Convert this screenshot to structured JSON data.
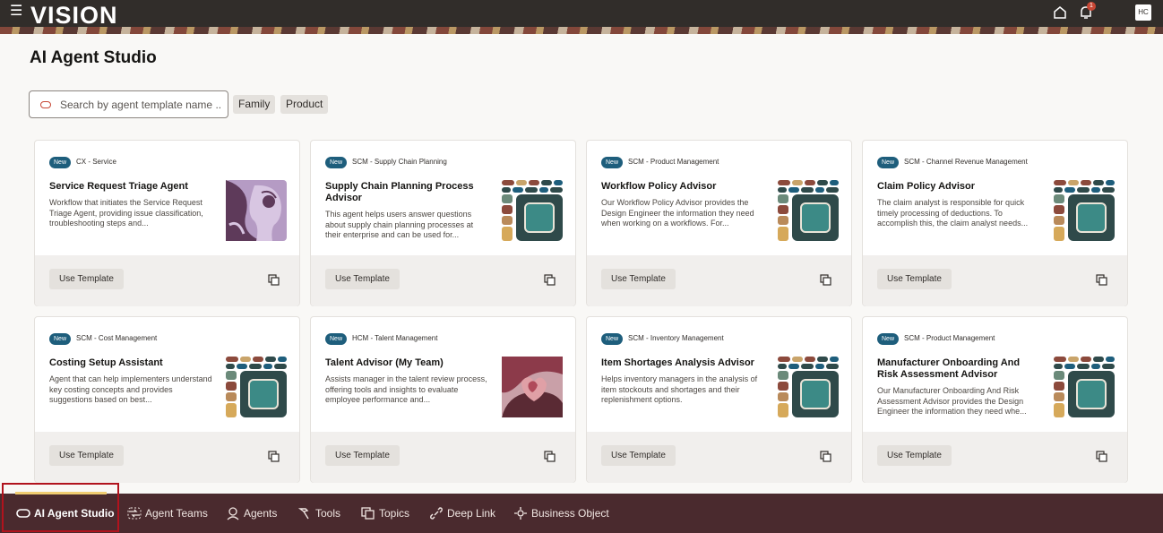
{
  "header": {
    "logo": "VISION",
    "notification_count": "1",
    "user_initials": "HC"
  },
  "page": {
    "title": "AI Agent Studio"
  },
  "search": {
    "placeholder": "Search by agent template name ..."
  },
  "filters": {
    "family": "Family",
    "product": "Product"
  },
  "cards": [
    {
      "badge": "New",
      "family": "CX - Service",
      "title": "Service Request Triage Agent",
      "description": "Workflow that initiates the Service Request Triage Agent, providing issue classification, troubleshooting steps and...",
      "button": "Use Template",
      "illustration": "face-illustration"
    },
    {
      "badge": "New",
      "family": "SCM - Supply Chain Planning",
      "title": "Supply Chain Planning Process Advisor",
      "description": "This agent helps users answer questions about supply chain planning processes at their enterprise and can be used for...",
      "button": "Use Template",
      "illustration": "tiles-illustration"
    },
    {
      "badge": "New",
      "family": "SCM - Product Management",
      "title": "Workflow Policy Advisor",
      "description": "Our Workflow Policy Advisor provides the Design Engineer the information they need when working on a workflows. For...",
      "button": "Use Template",
      "illustration": "tiles-illustration"
    },
    {
      "badge": "New",
      "family": "SCM - Channel Revenue Management",
      "title": "Claim Policy Advisor",
      "description": "The claim analyst is responsible for quick timely processing of deductions. To accomplish this, the claim analyst needs...",
      "button": "Use Template",
      "illustration": "tiles-illustration"
    },
    {
      "badge": "New",
      "family": "SCM - Cost Management",
      "title": "Costing Setup Assistant",
      "description": "Agent that can help implementers understand key costing concepts and provides suggestions based on best...",
      "button": "Use Template",
      "illustration": "tiles-illustration"
    },
    {
      "badge": "New",
      "family": "HCM - Talent Management",
      "title": "Talent Advisor (My Team)",
      "description": "Assists manager in the talent review process, offering tools and insights to evaluate employee performance and...",
      "button": "Use Template",
      "illustration": "heart-illustration"
    },
    {
      "badge": "New",
      "family": "SCM - Inventory Management",
      "title": "Item Shortages Analysis Advisor",
      "description": "Helps inventory managers in the analysis of item stockouts and shortages and their replenishment options.",
      "button": "Use Template",
      "illustration": "tiles-illustration"
    },
    {
      "badge": "New",
      "family": "SCM - Product Management",
      "title": "Manufacturer Onboarding And Risk Assessment Advisor",
      "description": "Our Manufacturer Onboarding And Risk Assessment Advisor provides the Design Engineer the information they need whe...",
      "button": "Use Template",
      "illustration": "tiles-illustration"
    }
  ],
  "bottom_nav": [
    {
      "label": "AI Agent Studio",
      "icon": "oval-icon",
      "active": true
    },
    {
      "label": "Agent Teams",
      "icon": "team-flow-icon",
      "active": false
    },
    {
      "label": "Agents",
      "icon": "agent-icon",
      "active": false
    },
    {
      "label": "Tools",
      "icon": "hammer-icon",
      "active": false
    },
    {
      "label": "Topics",
      "icon": "topics-icon",
      "active": false
    },
    {
      "label": "Deep Link",
      "icon": "link-icon",
      "active": false
    },
    {
      "label": "Business Object",
      "icon": "business-object-icon",
      "active": false
    }
  ],
  "colors": {
    "header_bg": "#312d2a",
    "nav_bg": "#4a2a2e",
    "badge_bg": "#1e5e7c",
    "accent_red": "#c74634",
    "active_indicator": "#f0cc71",
    "highlight_border": "#b1131d"
  }
}
